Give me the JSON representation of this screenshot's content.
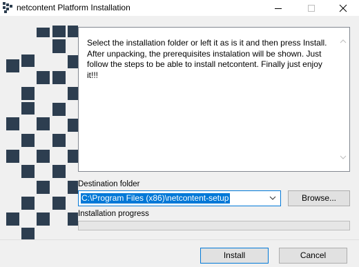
{
  "window": {
    "title": "netcontent Platform Installation",
    "title_bar_background": "#ffffff"
  },
  "icons": {
    "app": "app-logo-icon",
    "minimize": "minimize-icon",
    "maximize": "maximize-icon",
    "close": "close-icon",
    "scroll_up": "chevron-up-icon",
    "scroll_down": "chevron-down-icon",
    "dropdown": "chevron-down-icon"
  },
  "description": {
    "text": "Select the installation folder or left it as is it and then press Install. After unpacking, the prerequisites instalation will be shown. Just follow the steps to be able to install netcontent. Finally just enjoy it!!!"
  },
  "destination": {
    "label": "Destination folder",
    "value": "C:\\Program Files (x86)\\netcontent-setup",
    "browse_label": "Browse..."
  },
  "progress": {
    "label": "Installation progress",
    "percent": 0
  },
  "buttons": {
    "install": "Install",
    "cancel": "Cancel"
  },
  "colors": {
    "brand_pattern": "#2d3e50",
    "selection": "#0078d7",
    "progress_fill": "#06b025"
  }
}
